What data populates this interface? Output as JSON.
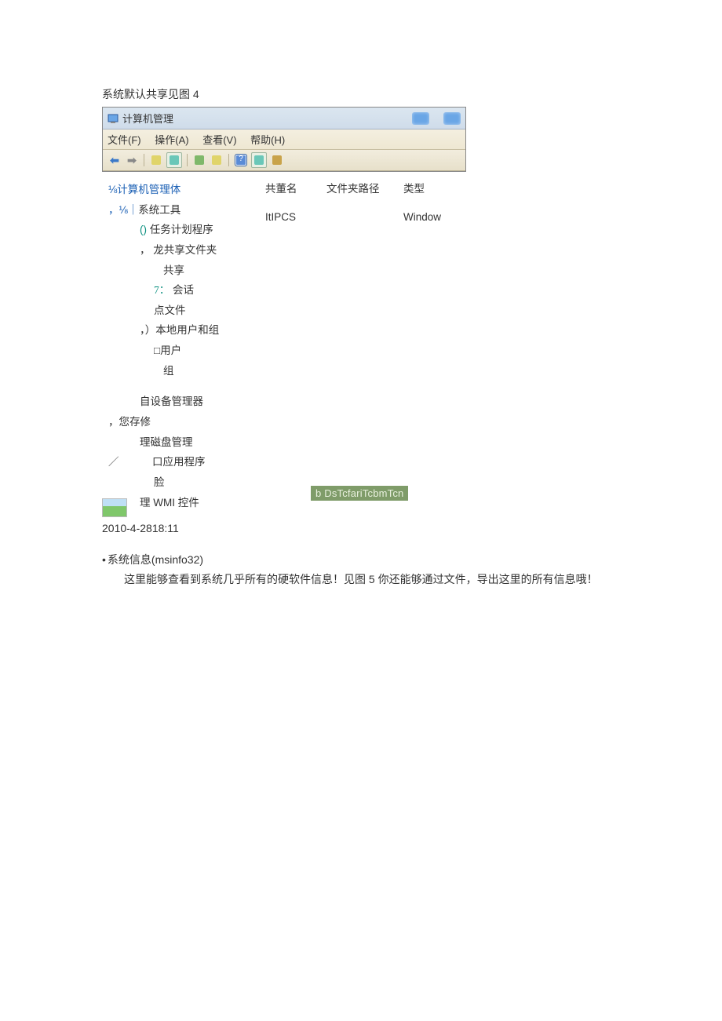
{
  "caption": "系统默认共享见图 4",
  "window": {
    "title": "计算机管理",
    "menu": {
      "file": "文件(F)",
      "action": "操作(A)",
      "view": "查看(V)",
      "help": "帮助(H)"
    }
  },
  "headers": {
    "name": "共董名",
    "path": "文件夹路径",
    "type": "类型"
  },
  "data": {
    "name": "ItIPCS",
    "path": "",
    "type": "Window"
  },
  "tree": {
    "root": "⅛计算机管理体",
    "r1_pre": "，⅛｜",
    "r1": "系统工具",
    "r2_pre": "()",
    "r2": "任务计划程序",
    "r3_pre": "，",
    "r3": "龙共享文件夹",
    "r4": "共享",
    "r5_pre": "7：",
    "r5": "会话",
    "r6": "点文件",
    "r7_pre": "，）",
    "r7": "本地用户和组",
    "r8_pre": "□",
    "r8": "用户",
    "r9": "组",
    "r10": "自设备管理器",
    "r11_pre": "，您",
    "r11": "存修",
    "r12": "理磁盘管理",
    "r13_pre": "／",
    "r13": "口应用程序",
    "r14": "脸",
    "r15_pre": "理",
    "r15": " WMI 控件"
  },
  "watermark": "b DsTcfariTcbmTcn",
  "timestamp": "2010-4-2818:11",
  "section": {
    "title": "系统信息(msinfo32)",
    "body": "这里能够查看到系统几乎所有的硬软件信息！见图 5 你还能够通过文件，导出这里的所有信息哦！"
  }
}
